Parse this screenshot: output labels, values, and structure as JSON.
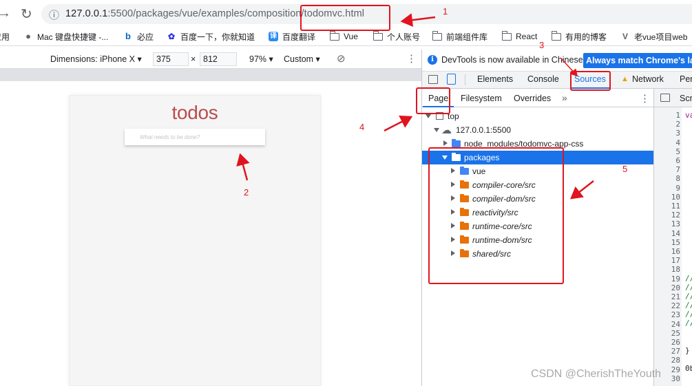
{
  "browser": {
    "back_glyph": "→",
    "reload_glyph": "↻",
    "info_glyph": "ⓘ",
    "url_host": "127.0.0.1",
    "url_path": ":5500/packages/vue/examples/composition/todomvc.html"
  },
  "bookmarks": [
    {
      "label": "应用",
      "icon": "apps-icon"
    },
    {
      "label": "Mac 键盘快捷键 -...",
      "icon": "apple-icon"
    },
    {
      "label": "必应",
      "icon": "bing-icon"
    },
    {
      "label": "百度一下，你就知道",
      "icon": "baidu-icon"
    },
    {
      "label": "百度翻译",
      "icon": "translate-icon"
    },
    {
      "label": "Vue",
      "icon": "folder-icon"
    },
    {
      "label": "个人账号",
      "icon": "folder-icon"
    },
    {
      "label": "前端组件库",
      "icon": "folder-icon"
    },
    {
      "label": "React",
      "icon": "folder-icon"
    },
    {
      "label": "有用的博客",
      "icon": "folder-icon"
    },
    {
      "label": "老vue项目web",
      "icon": "vue-icon"
    }
  ],
  "device_toolbar": {
    "dimensions_label": "Dimensions: iPhone X ▾",
    "width": "375",
    "times": "×",
    "height": "812",
    "zoom": "97% ▾",
    "throttle": "Custom ▾",
    "rotate_glyph": "⊘",
    "more_glyph": "⋮"
  },
  "app": {
    "title": "todos",
    "input_placeholder": "What needs to be done?"
  },
  "devtools": {
    "info_text": "DevTools is now available in Chinese!",
    "match_button": "Always match Chrome's language",
    "tabs": [
      "Elements",
      "Console",
      "Sources",
      "Network",
      "Performance"
    ],
    "active_tab": "Sources",
    "subtabs": [
      "Page",
      "Filesystem",
      "Overrides"
    ],
    "more_tabs_glyph": "»",
    "kebab_glyph": "⋮",
    "editor_tab": "Script"
  },
  "tree": {
    "top": "top",
    "host": "127.0.0.1:5500",
    "node_modules": "node_modules/todomvc-app-css",
    "packages": "packages",
    "children": [
      "vue",
      "compiler-core/src",
      "compiler-dom/src",
      "reactivity/src",
      "runtime-core/src",
      "runtime-dom/src",
      "shared/src"
    ]
  },
  "code": {
    "line_numbers": [
      "1",
      "2",
      "3",
      "4",
      "5",
      "6",
      "7",
      "8",
      "9",
      "10",
      "11",
      "12",
      "13",
      "14",
      "15",
      "16",
      "17",
      "18",
      "19",
      "20",
      "21",
      "22",
      "23",
      "24",
      "25",
      "26",
      "27",
      "28",
      "29",
      "30"
    ],
    "line1": "va",
    "comment": "//",
    "brace": "}",
    "line29": "0b"
  },
  "annotations": [
    "1",
    "2",
    "3",
    "4",
    "5"
  ],
  "watermark": "CSDN @CherishTheYouth",
  "colors": {
    "accent": "#1a73e8",
    "annotation_red": "#e0141e",
    "folder_blue": "#4285f4",
    "folder_orange": "#e8710a",
    "todos_red": "#af2f2f"
  }
}
